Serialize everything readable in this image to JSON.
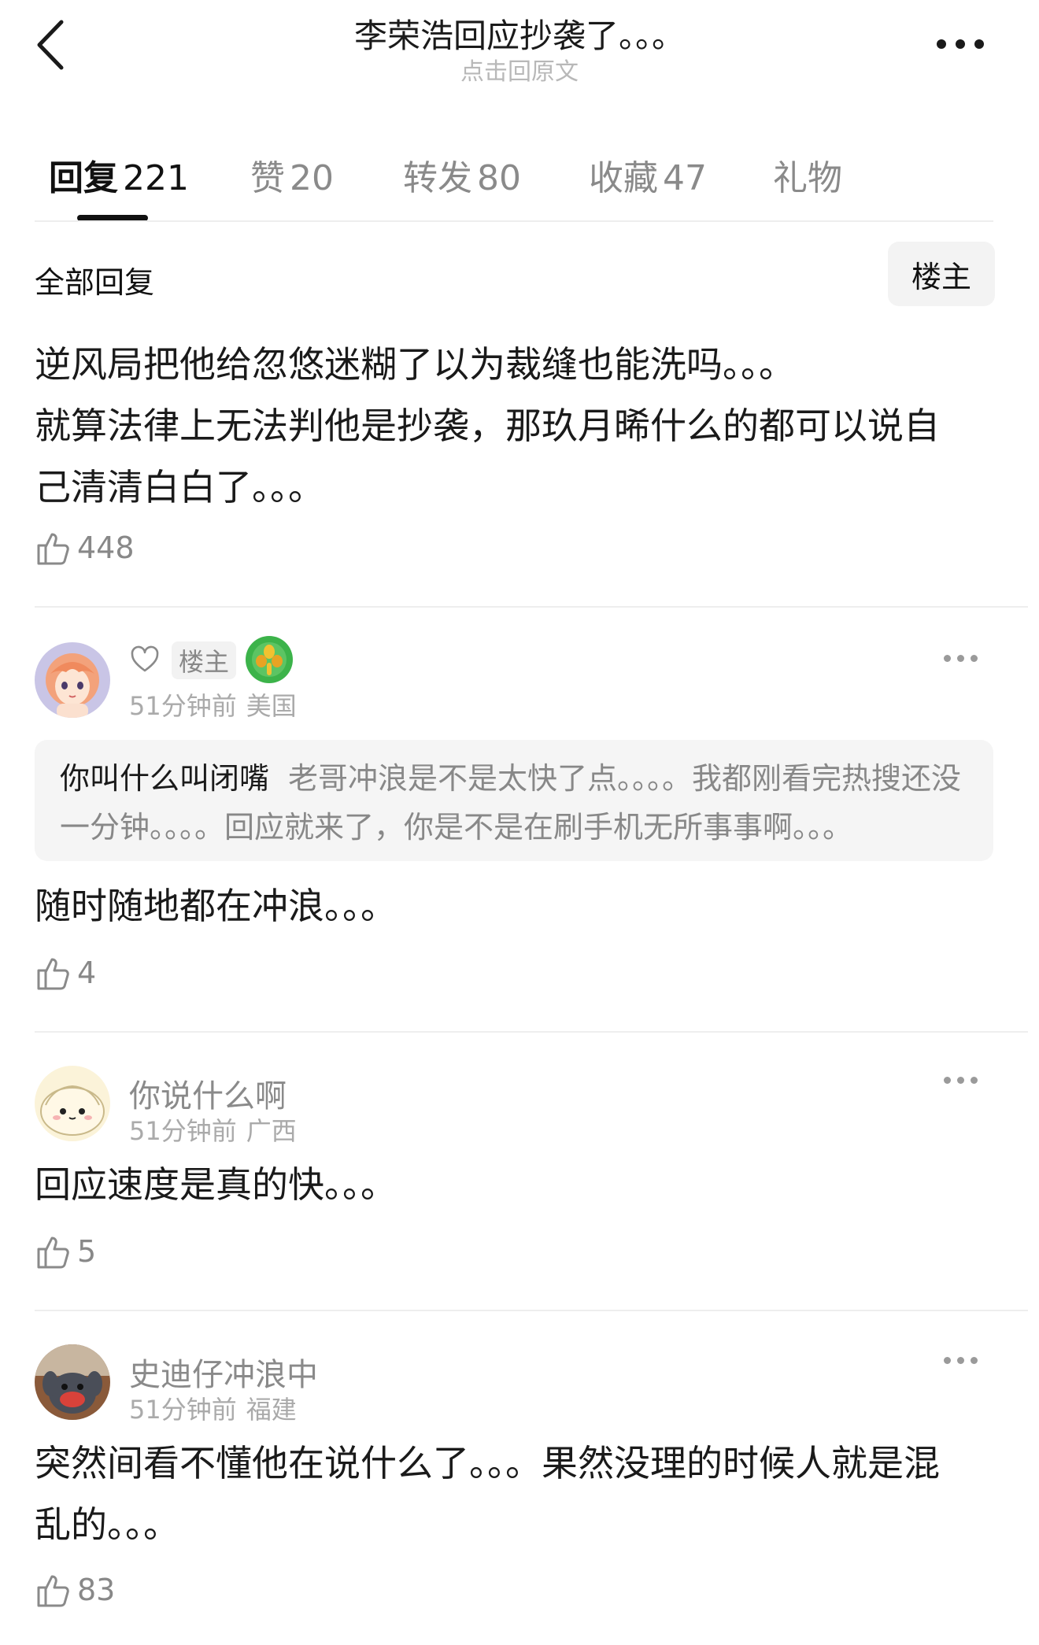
{
  "header": {
    "title": "李荣浩回应抄袭了。。。",
    "subtitle": "点击回原文"
  },
  "tabs": [
    {
      "label": "回复",
      "count": "221"
    },
    {
      "label": "赞",
      "count": "20"
    },
    {
      "label": "转发",
      "count": "80"
    },
    {
      "label": "收藏",
      "count": "47"
    },
    {
      "label": "礼物",
      "count": ""
    }
  ],
  "filter": {
    "all_replies": "全部回复",
    "owner_only": "楼主"
  },
  "main_post": {
    "lines": [
      "逆风局把他给忽悠迷糊了以为裁缝也能洗吗。。。",
      "就算法律上无法判他是抄袭，那玖月晞什么的都可以说自",
      "己清清白白了。。。"
    ],
    "likes": "448"
  },
  "replies": [
    {
      "badge": "楼主",
      "time": "51分钟前",
      "location": "美国",
      "quote_name": "你叫什么叫闭嘴",
      "quote_text": "老哥冲浪是不是太快了点。。。。我都刚看完热搜还没一分钟。。。。回应就来了，你是不是在刷手机无所事事啊。。。",
      "text": "随时随地都在冲浪。。。",
      "likes": "4"
    },
    {
      "name": "你说什么啊",
      "time": "51分钟前",
      "location": "广西",
      "text": "回应速度是真的快。。。",
      "likes": "5"
    },
    {
      "name": "史迪仔冲浪中",
      "time": "51分钟前",
      "location": "福建",
      "lines": [
        "突然间看不懂他在说什么了。。。果然没理的时候人就是混",
        "乱的。。。"
      ],
      "likes": "83"
    }
  ],
  "icons": {
    "back": "chevron-left-icon",
    "more": "more-horizontal-icon",
    "like": "thumbs-up-icon",
    "follow": "heart-outline-icon",
    "level": "level-badge-icon"
  },
  "colors": {
    "text": "#1a1a1a",
    "muted": "#8a8a8a",
    "divider": "#eeeeee",
    "quote_bg": "#f5f5f5",
    "level_badge": "#3cb34a"
  }
}
